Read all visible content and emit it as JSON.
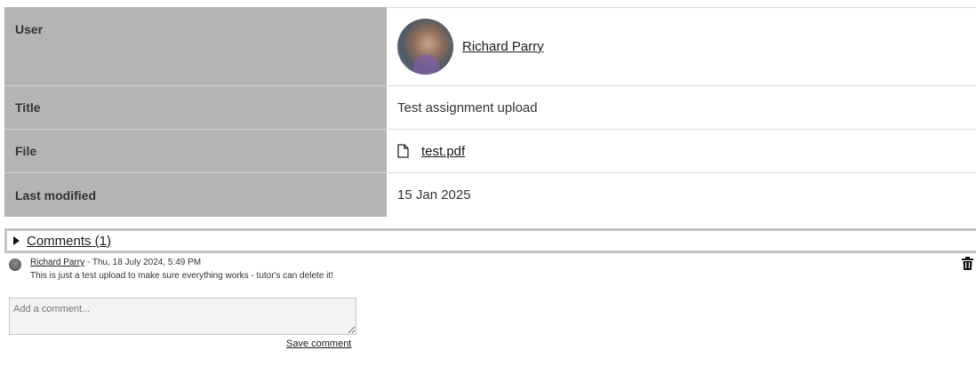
{
  "details": {
    "user_label": "User",
    "user_name": "Richard Parry",
    "title_label": "Title",
    "title_value": "Test assignment upload",
    "file_label": "File",
    "file_name": "test.pdf",
    "modified_label": "Last modified",
    "modified_value": "15 Jan 2025"
  },
  "comments": {
    "toggle_label": "Comments (1)",
    "items": [
      {
        "author": "Richard Parry",
        "date": " - Thu, 18 July 2024, 5:49 PM",
        "text": "This is just a test upload to make sure everything works - tutor's can delete it!"
      }
    ],
    "input_placeholder": "Add a comment...",
    "save_label": "Save comment"
  },
  "icons": {
    "file": "file-icon",
    "trash": "trash-icon",
    "toggle": "caret-right-icon"
  }
}
